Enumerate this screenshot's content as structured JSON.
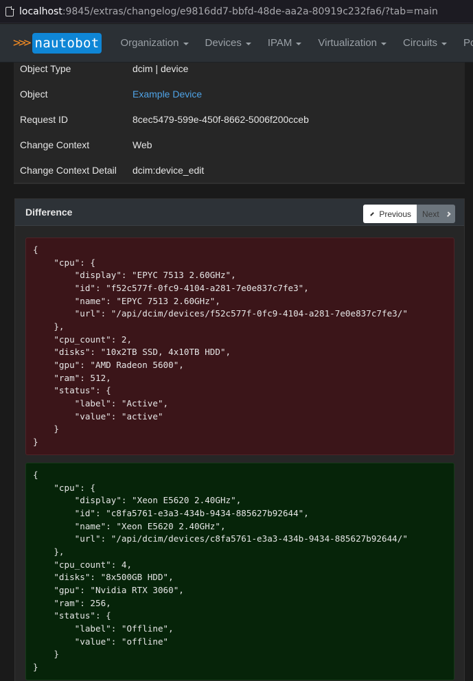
{
  "browser": {
    "url_host": "localhost",
    "url_rest": ":9845/extras/changelog/e9816dd7-bbfd-48de-aa2a-80919c232fa6/?tab=main"
  },
  "navbar": {
    "logo_chevrons": ">>>",
    "logo_text": "nautobot",
    "items": [
      "Organization",
      "Devices",
      "IPAM",
      "Virtualization",
      "Circuits",
      "Pow"
    ]
  },
  "attributes": [
    {
      "label": "Object Type",
      "value": "dcim | device"
    },
    {
      "label": "Object",
      "value": "Example Device"
    },
    {
      "label": "Request ID",
      "value": "8cec5479-599e-450f-8662-5006f200cceb"
    },
    {
      "label": "Change Context",
      "value": "Web"
    },
    {
      "label": "Change Context Detail",
      "value": "dcim:device_edit"
    }
  ],
  "difference": {
    "title": "Difference",
    "previous_label": "Previous",
    "next_label": "Next",
    "removed": "{\n    \"cpu\": {\n        \"display\": \"EPYC 7513 2.60GHz\",\n        \"id\": \"f52c577f-0fc9-4104-a281-7e0e837c7fe3\",\n        \"name\": \"EPYC 7513 2.60GHz\",\n        \"url\": \"/api/dcim/devices/f52c577f-0fc9-4104-a281-7e0e837c7fe3/\"\n    },\n    \"cpu_count\": 2,\n    \"disks\": \"10x2TB SSD, 4x10TB HDD\",\n    \"gpu\": \"AMD Radeon 5600\",\n    \"ram\": 512,\n    \"status\": {\n        \"label\": \"Active\",\n        \"value\": \"active\"\n    }\n}",
    "added": "{\n    \"cpu\": {\n        \"display\": \"Xeon E5620 2.40GHz\",\n        \"id\": \"c8fa5761-e3a3-434b-9434-885627b92644\",\n        \"name\": \"Xeon E5620 2.40GHz\",\n        \"url\": \"/api/dcim/devices/c8fa5761-e3a3-434b-9434-885627b92644/\"\n    },\n    \"cpu_count\": 4,\n    \"disks\": \"8x500GB HDD\",\n    \"gpu\": \"Nvidia RTX 3060\",\n    \"ram\": 256,\n    \"status\": {\n        \"label\": \"Offline\",\n        \"value\": \"offline\"\n    }\n}"
  }
}
